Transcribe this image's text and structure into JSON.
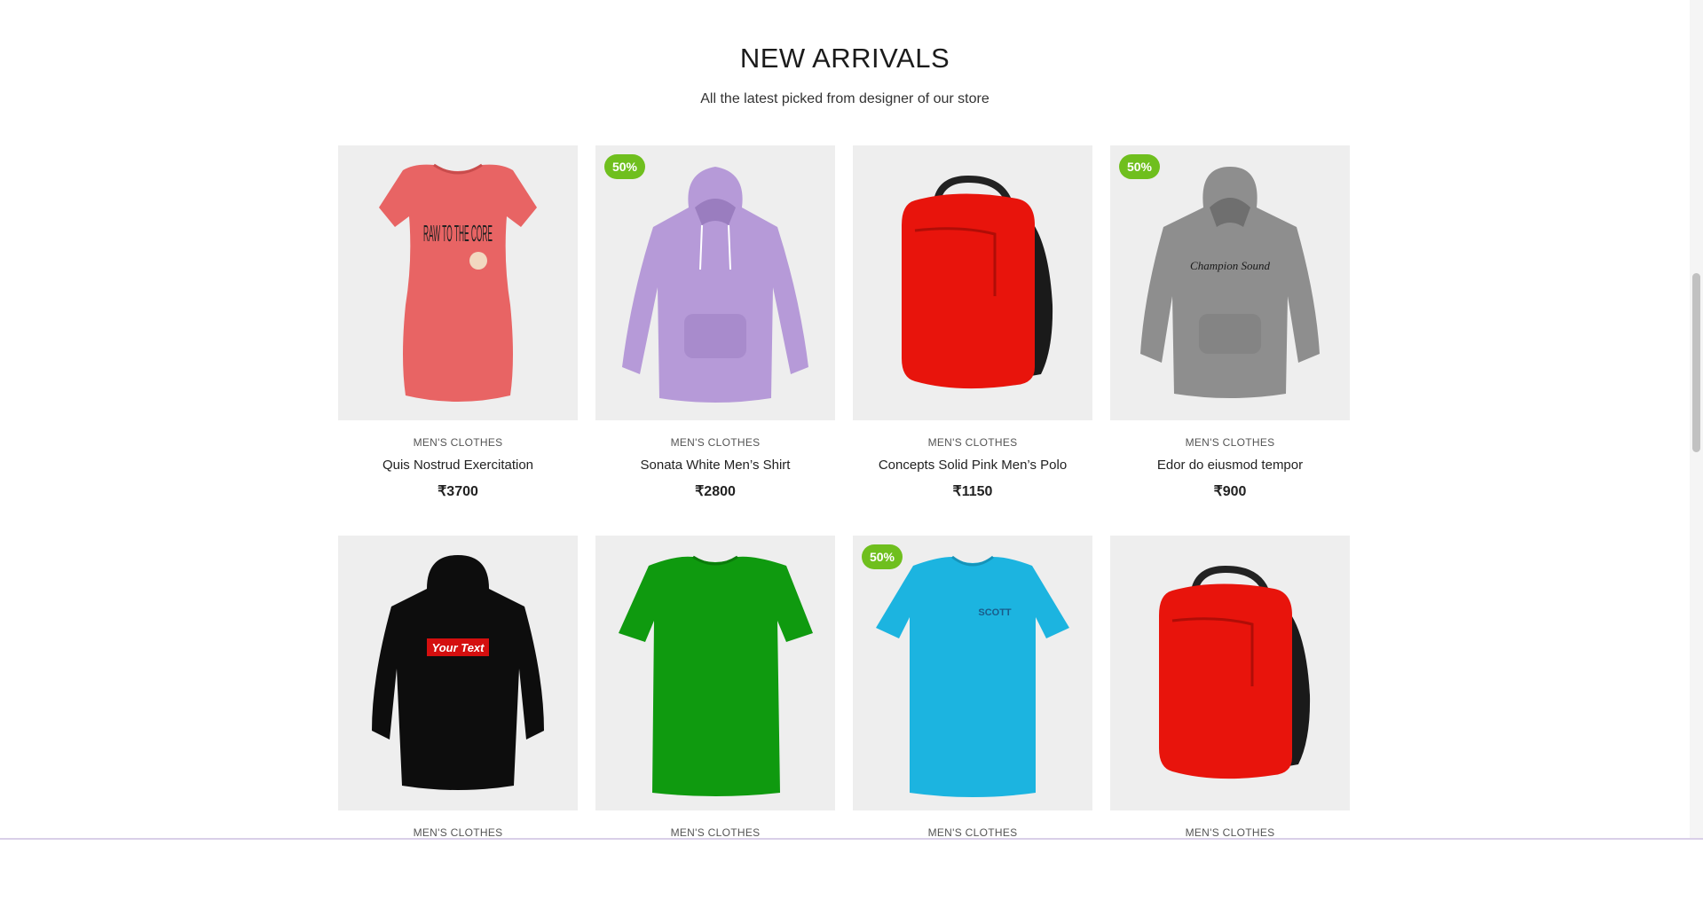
{
  "section": {
    "title": "NEW ARRIVALS",
    "subtitle": "All the latest picked from designer of our store"
  },
  "products": [
    {
      "category": "MEN'S CLOTHES",
      "name": "Quis Nostrud Exercitation",
      "price": "₹3700",
      "badge": "",
      "image": "pink-tshirt",
      "print_text": "RAW TO THE CORE"
    },
    {
      "category": "MEN'S CLOTHES",
      "name": "Sonata White Men’s Shirt",
      "price": "₹2800",
      "badge": "50%",
      "image": "lavender-hoodie"
    },
    {
      "category": "MEN'S CLOTHES",
      "name": "Concepts Solid Pink Men’s Polo",
      "price": "₹1150",
      "badge": "",
      "image": "red-backpack"
    },
    {
      "category": "MEN'S CLOTHES",
      "name": "Edor do eiusmod tempor",
      "price": "₹900",
      "badge": "50%",
      "image": "grey-hoodie",
      "print_text": "Champion Sound"
    },
    {
      "category": "MEN'S CLOTHES",
      "name": "",
      "price": "",
      "badge": "",
      "image": "black-hoodie",
      "print_text": "Your Text"
    },
    {
      "category": "MEN'S CLOTHES",
      "name": "",
      "price": "",
      "badge": "",
      "image": "green-tshirt"
    },
    {
      "category": "MEN'S CLOTHES",
      "name": "",
      "price": "",
      "badge": "50%",
      "image": "blue-tshirt",
      "print_text": "SCOTT"
    },
    {
      "category": "MEN'S CLOTHES",
      "name": "",
      "price": "",
      "badge": "",
      "image": "red-backpack"
    }
  ],
  "colors": {
    "badge": "#6fbf1e",
    "image_bg": "#eeeeee"
  }
}
